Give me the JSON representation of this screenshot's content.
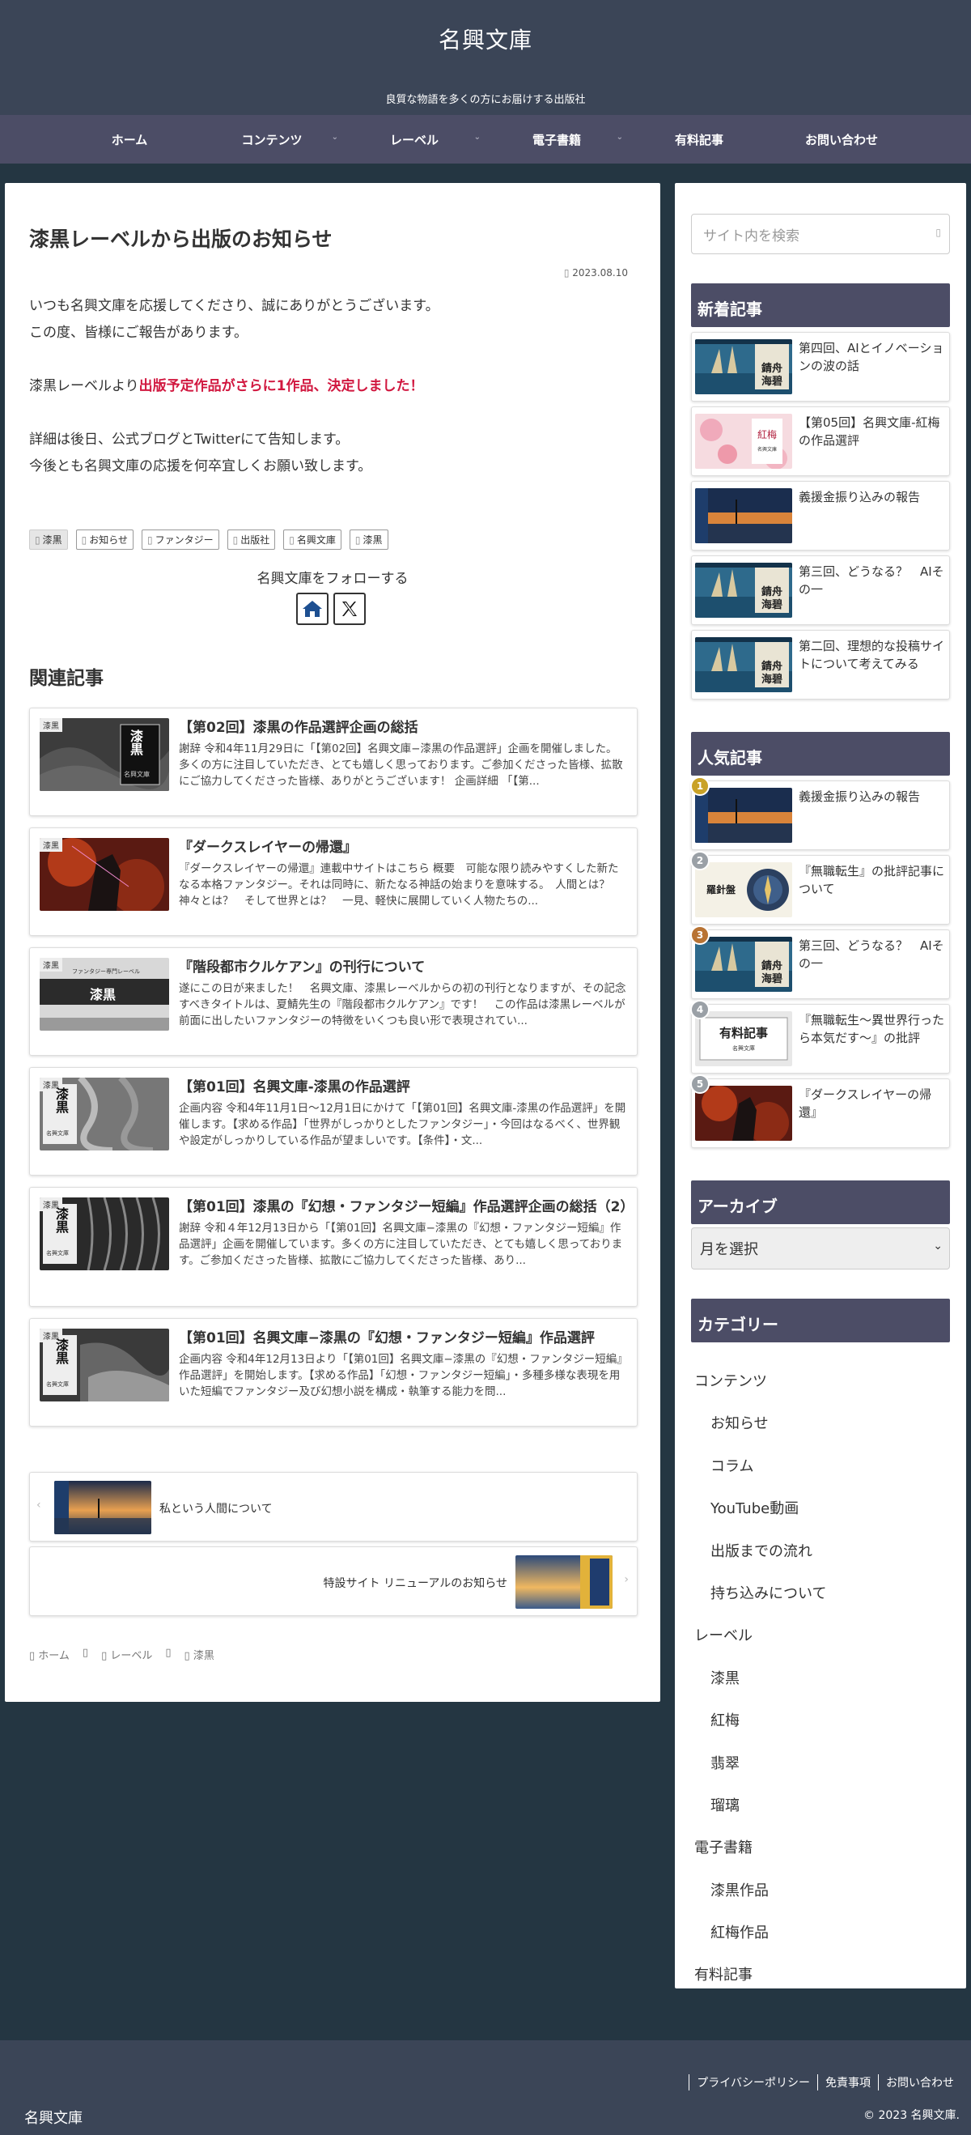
{
  "header": {
    "site_title": "名興文庫",
    "tagline": "良質な物語を多くの方にお届けする出版社"
  },
  "nav": {
    "items": [
      {
        "label": "ホーム",
        "has_dropdown": false
      },
      {
        "label": "コンテンツ",
        "has_dropdown": true
      },
      {
        "label": "レーベル",
        "has_dropdown": true
      },
      {
        "label": "電子書籍",
        "has_dropdown": true
      },
      {
        "label": "有料記事",
        "has_dropdown": false
      },
      {
        "label": "お問い合わせ",
        "has_dropdown": false
      }
    ]
  },
  "article": {
    "title": "漆黒レーベルから出版のお知らせ",
    "date": "2023.08.10",
    "p1": "いつも名興文庫を応援してくださり、誠にありがとうございます。",
    "p2": "この度、皆様にご報告があります。",
    "p3_prefix": "漆黒レーベルより",
    "p3_highlight": "出版予定作品がさらに1作品、決定しました！",
    "p4": "詳細は後日、公式ブログとTwitterにて告知します。",
    "p5": "今後とも名興文庫の応援を何卒宜しくお願い致します。",
    "tags": [
      "漆黒",
      "お知らせ",
      "ファンタジー",
      "出版社",
      "名興文庫",
      "漆黒"
    ],
    "follow_text": "名興文庫をフォローする",
    "highlight_color": "#d1173f"
  },
  "related": {
    "heading": "関連記事",
    "items": [
      {
        "label": "漆黒",
        "title": "【第02回】漆黒の作品選評企画の総括",
        "excerpt": "謝辞 令和4年11月29日に「【第02回】名興文庫−漆黒の作品選評」企画を開催しました。多くの方に注目していただき、とても嬉しく思っております。ご参加くださった皆様、拡散にご協力してくださった皆様、ありがとうございます！ 企画詳細 「【第...",
        "thumb_text": "漆黒",
        "thumb_sub": "名興文庫"
      },
      {
        "label": "漆黒",
        "title": "『ダークスレイヤーの帰還』",
        "excerpt": "『ダークスレイヤーの帰還』連載中サイトはこちら 概要　可能な限り読みやすくした新たなる本格ファンタジー。それは同時に、新たなる神話の始まりを意味する。　人間とは？　神々とは？　そして世界とは？　一見、軽快に展開していく人物たちの...",
        "thumb_text": "",
        "thumb_sub": ""
      },
      {
        "label": "漆黒",
        "title": "『階段都市クルケアン』の刊行について",
        "excerpt": "遂にこの日が来ました！　名興文庫、漆黒レーベルからの初の刊行となりますが、その記念すべきタイトルは、夏鯖先生の『階段都市クルケアン』です！　この作品は漆黒レーベルが前面に出したいファンタジーの特徴をいくつも良い形で表現されてい...",
        "thumb_text": "漆黒",
        "thumb_sub": "ファンタジー専門レーベル"
      },
      {
        "label": "漆黒",
        "title": "【第01回】名興文庫-漆黒の作品選評",
        "excerpt": "企画内容 令和4年11月1日〜12月1日にかけて「【第01回】名興文庫-漆黒の作品選評」を開催します。【求める作品】「世界がしっかりとしたファンタジー」・今回はなるべく、世界観や設定がしっかりしている作品が望ましいです。【条件】・文...",
        "thumb_text": "漆黒",
        "thumb_sub": "名興文庫"
      },
      {
        "label": "漆黒",
        "title": "【第01回】漆黒の『幻想・ファンタジー短編』作品選評企画の総括（2）",
        "excerpt": "謝辞 令和４年12月13日から「【第01回】名興文庫−漆黒の『幻想・ファンタジー短編』作品選評」企画を開催しています。多くの方に注目していただき、とても嬉しく思っております。ご参加くださった皆様、拡散にご協力してくださった皆様、あり...",
        "thumb_text": "漆黒",
        "thumb_sub": "名興文庫"
      },
      {
        "label": "漆黒",
        "title": "【第01回】名興文庫−漆黒の『幻想・ファンタジー短編』作品選評",
        "excerpt": "企画内容 令和4年12月13日より「【第01回】名興文庫−漆黒の『幻想・ファンタジー短編』作品選評」を開始します。【求める作品】「幻想・ファンタジー短編」・多種多様な表現を用いた短編でファンタジー及び幻想小説を構成・執筆する能力を問...",
        "thumb_text": "漆黒",
        "thumb_sub": "名興文庫"
      }
    ]
  },
  "pager": {
    "prev_title": "私という人間について",
    "next_title": "特設サイト リニューアルのお知らせ"
  },
  "breadcrumb": [
    "ホーム",
    "レーベル",
    "漆黒"
  ],
  "sidebar": {
    "search_placeholder": "サイト内を検索",
    "new_heading": "新着記事",
    "new_items": [
      {
        "title": "第四回、AIとイノベーションの波の話",
        "thumb": "ship"
      },
      {
        "title": "【第05回】名興文庫-紅梅の作品選評",
        "thumb": "plum"
      },
      {
        "title": "義援金振り込みの報告",
        "thumb": "sunset"
      },
      {
        "title": "第三回、どうなる？　AIその一",
        "thumb": "ship"
      },
      {
        "title": "第二回、理想的な投稿サイトについて考えてみる",
        "thumb": "ship"
      }
    ],
    "popular_heading": "人気記事",
    "popular_items": [
      {
        "rank": "1",
        "title": "義援金振り込みの報告",
        "thumb": "sunset",
        "rank_color": "#c9a227"
      },
      {
        "rank": "2",
        "title": "『無職転生』の批評記事について",
        "thumb": "compass",
        "rank_color": "#9aa0a6"
      },
      {
        "rank": "3",
        "title": "第三回、どうなる？　AIその一",
        "thumb": "ship",
        "rank_color": "#b87333"
      },
      {
        "rank": "4",
        "title": "『無職転生〜異世界行ったら本気だす〜』の批評",
        "thumb": "paid",
        "rank_color": "#9aa0a6"
      },
      {
        "rank": "5",
        "title": "『ダークスレイヤーの帰還』",
        "thumb": "warrior",
        "rank_color": "#9aa0a6"
      }
    ],
    "archive_heading": "アーカイブ",
    "archive_select": "月を選択",
    "category_heading": "カテゴリー",
    "categories": [
      {
        "label": "コンテンツ",
        "level": "parent"
      },
      {
        "label": "お知らせ",
        "level": "child"
      },
      {
        "label": "コラム",
        "level": "child"
      },
      {
        "label": "YouTube動画",
        "level": "child"
      },
      {
        "label": "出版までの流れ",
        "level": "child"
      },
      {
        "label": "持ち込みについて",
        "level": "child"
      },
      {
        "label": "レーベル",
        "level": "parent"
      },
      {
        "label": "漆黒",
        "level": "child"
      },
      {
        "label": "紅梅",
        "level": "child"
      },
      {
        "label": "翡翠",
        "level": "child"
      },
      {
        "label": "瑠璃",
        "level": "child"
      },
      {
        "label": "電子書籍",
        "level": "parent"
      },
      {
        "label": "漆黒作品",
        "level": "child"
      },
      {
        "label": "紅梅作品",
        "level": "child"
      },
      {
        "label": "有料記事",
        "level": "parent"
      }
    ]
  },
  "footer": {
    "brand": "名興文庫",
    "links": [
      "プライバシーポリシー",
      "免責事項",
      "お問い合わせ"
    ],
    "copyright": "© 2023 名興文庫."
  },
  "thumb_texts": {
    "ship_title": "錆舟海碧",
    "plum_title": "紅梅",
    "plum_sub": "名興文庫",
    "compass_title": "羅針盤",
    "paid_title": "有料記事",
    "paid_sub": "名興文庫"
  },
  "colors": {
    "header_bg": "#3b4557",
    "nav_bg": "#4c4d66",
    "page_bg": "#243642",
    "widget_heading_bg": "#4c4d66"
  }
}
